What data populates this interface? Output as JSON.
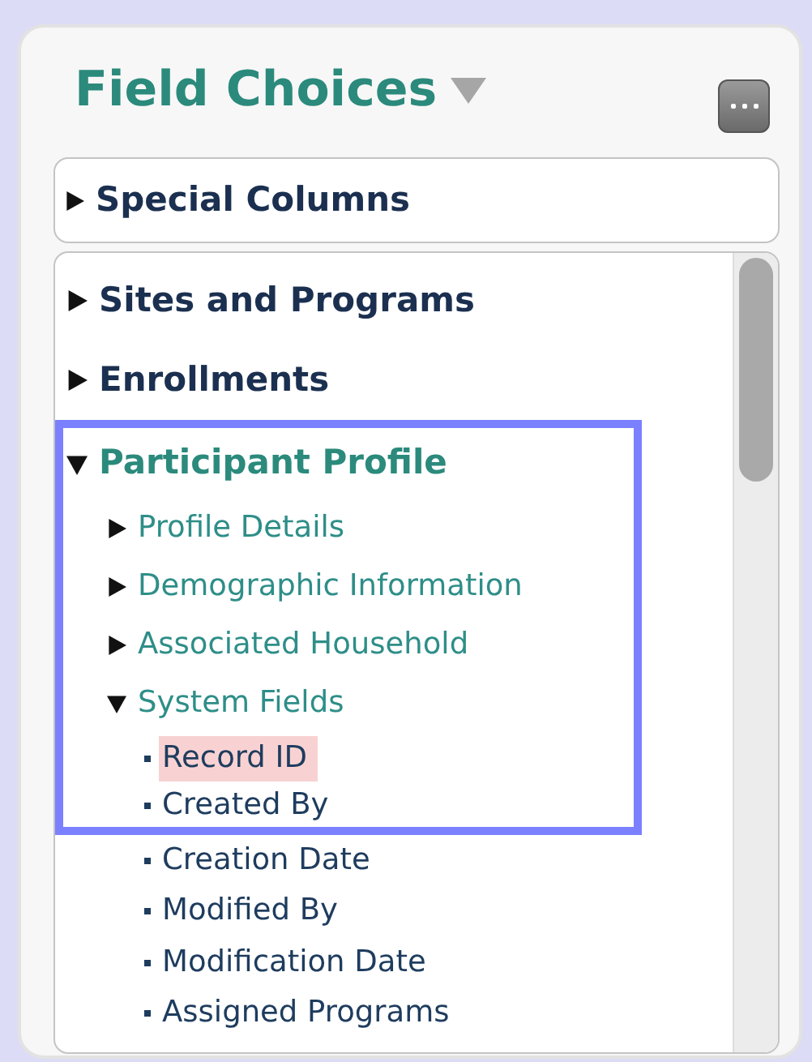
{
  "panel": {
    "title": "Field Choices"
  },
  "special": {
    "label": "Special Columns",
    "expanded": false
  },
  "tree": [
    {
      "kind": "group",
      "label": "Sites and Programs",
      "expanded": false,
      "highlighted": false
    },
    {
      "kind": "group",
      "label": "Enrollments",
      "expanded": false,
      "highlighted": false
    },
    {
      "kind": "group",
      "label": "Participant Profile",
      "expanded": true,
      "highlighted": true,
      "children": [
        {
          "kind": "section",
          "label": "Profile Details",
          "expanded": false,
          "highlighted": true
        },
        {
          "kind": "section",
          "label": "Demographic Information",
          "expanded": false,
          "highlighted": true
        },
        {
          "kind": "section",
          "label": "Associated Household",
          "expanded": false,
          "highlighted": true
        },
        {
          "kind": "section",
          "label": "System Fields",
          "expanded": true,
          "highlighted": true,
          "children": [
            {
              "kind": "field",
              "label": "Record ID",
              "selected": true,
              "highlighted": true
            },
            {
              "kind": "field",
              "label": "Created By",
              "selected": false,
              "highlighted": true
            },
            {
              "kind": "field",
              "label": "Creation Date",
              "selected": false,
              "highlighted": false
            },
            {
              "kind": "field",
              "label": "Modified By",
              "selected": false,
              "highlighted": false
            },
            {
              "kind": "field",
              "label": "Modification Date",
              "selected": false,
              "highlighted": false
            },
            {
              "kind": "field",
              "label": "Assigned Programs",
              "selected": false,
              "highlighted": false
            }
          ]
        }
      ]
    }
  ]
}
